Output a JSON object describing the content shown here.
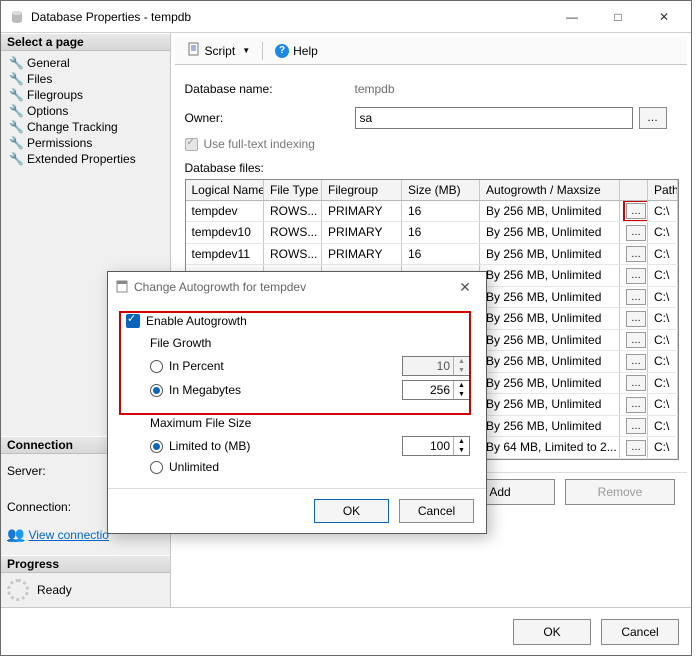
{
  "window": {
    "title": "Database Properties - tempdb"
  },
  "left": {
    "select_page": "Select a page",
    "pages": [
      "General",
      "Files",
      "Filegroups",
      "Options",
      "Change Tracking",
      "Permissions",
      "Extended Properties"
    ],
    "connection_hdr": "Connection",
    "server_label": "Server:",
    "connection_label": "Connection:",
    "view_conn": "View connectio",
    "progress_hdr": "Progress",
    "progress_text": "Ready"
  },
  "toolbar": {
    "script": "Script",
    "help": "Help"
  },
  "form": {
    "dbname_label": "Database name:",
    "dbname_value": "tempdb",
    "owner_label": "Owner:",
    "owner_value": "sa",
    "fulltext": "Use full-text indexing",
    "files_label": "Database files:"
  },
  "grid": {
    "headers": [
      "Logical Name",
      "File Type",
      "Filegroup",
      "Size (MB)",
      "Autogrowth / Maxsize",
      "",
      "Path"
    ],
    "rows": [
      {
        "name": "tempdev",
        "type": "ROWS...",
        "fg": "PRIMARY",
        "size": "16",
        "ag": "By 256 MB, Unlimited",
        "path": "C:\\"
      },
      {
        "name": "tempdev10",
        "type": "ROWS...",
        "fg": "PRIMARY",
        "size": "16",
        "ag": "By 256 MB, Unlimited",
        "path": "C:\\"
      },
      {
        "name": "tempdev11",
        "type": "ROWS...",
        "fg": "PRIMARY",
        "size": "16",
        "ag": "By 256 MB, Unlimited",
        "path": "C:\\"
      },
      {
        "name": "",
        "type": "",
        "fg": "",
        "size": "",
        "ag": "By 256 MB, Unlimited",
        "path": "C:\\"
      },
      {
        "name": "",
        "type": "",
        "fg": "",
        "size": "",
        "ag": "By 256 MB, Unlimited",
        "path": "C:\\"
      },
      {
        "name": "",
        "type": "",
        "fg": "",
        "size": "",
        "ag": "By 256 MB, Unlimited",
        "path": "C:\\"
      },
      {
        "name": "",
        "type": "",
        "fg": "",
        "size": "",
        "ag": "By 256 MB, Unlimited",
        "path": "C:\\"
      },
      {
        "name": "",
        "type": "",
        "fg": "",
        "size": "",
        "ag": "By 256 MB, Unlimited",
        "path": "C:\\"
      },
      {
        "name": "",
        "type": "",
        "fg": "",
        "size": "",
        "ag": "By 256 MB, Unlimited",
        "path": "C:\\"
      },
      {
        "name": "",
        "type": "",
        "fg": "",
        "size": "",
        "ag": "By 256 MB, Unlimited",
        "path": "C:\\"
      },
      {
        "name": "",
        "type": "",
        "fg": "",
        "size": "",
        "ag": "By 256 MB, Unlimited",
        "path": "C:\\"
      },
      {
        "name": "",
        "type": "",
        "fg": "",
        "size": "",
        "ag": "By 64 MB, Limited to 2...",
        "path": "C:\\"
      }
    ]
  },
  "buttons": {
    "add": "Add",
    "remove": "Remove",
    "ok": "OK",
    "cancel": "Cancel"
  },
  "dialog": {
    "title": "Change Autogrowth for tempdev",
    "enable": "Enable Autogrowth",
    "file_growth": "File Growth",
    "in_percent": "In Percent",
    "in_mb": "In Megabytes",
    "percent_val": "10",
    "mb_val": "256",
    "max_fs": "Maximum File Size",
    "limited": "Limited to (MB)",
    "unlimited": "Unlimited",
    "limit_val": "100",
    "ok": "OK",
    "cancel": "Cancel"
  }
}
